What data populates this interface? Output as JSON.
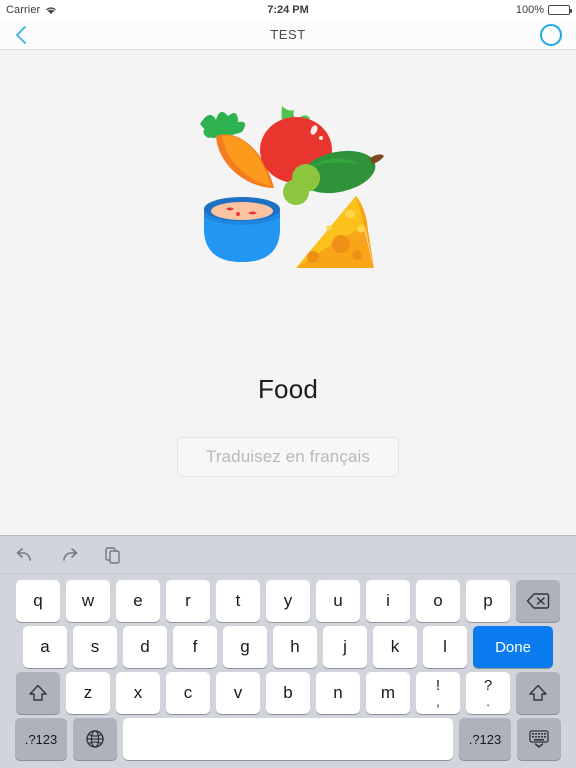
{
  "status_bar": {
    "carrier": "Carrier",
    "wifi_icon": "wifi-icon",
    "time": "7:24 PM",
    "battery_percent": "100%",
    "battery_icon": "battery-full-icon"
  },
  "nav_bar": {
    "back_icon": "chevron-left-icon",
    "title": "TEST",
    "right_icon": "circle-outline-icon",
    "accent_color": "#20a8e8"
  },
  "main": {
    "illustration_name": "food-illustration",
    "illustration_items": [
      "carrot",
      "tomato",
      "cucumber",
      "peas",
      "soup-bowl",
      "cheese-wedge"
    ],
    "word": "Food",
    "answer_input": {
      "value": "",
      "placeholder": "Traduisez en français"
    }
  },
  "keyboard": {
    "toolbar": [
      {
        "name": "undo-icon",
        "label": "undo"
      },
      {
        "name": "redo-icon",
        "label": "redo"
      },
      {
        "name": "paste-icon",
        "label": "paste"
      }
    ],
    "row1": [
      "q",
      "w",
      "e",
      "r",
      "t",
      "y",
      "u",
      "i",
      "o",
      "p"
    ],
    "row1_action": {
      "name": "backspace-key",
      "label": "delete"
    },
    "row2": [
      "a",
      "s",
      "d",
      "f",
      "g",
      "h",
      "j",
      "k",
      "l"
    ],
    "row2_action": {
      "name": "done-key",
      "label": "Done"
    },
    "row3": [
      "z",
      "x",
      "c",
      "v",
      "b",
      "n",
      "m"
    ],
    "row3_punctuation": [
      {
        "top": "!",
        "bottom": ","
      },
      {
        "top": "?",
        "bottom": "."
      }
    ],
    "shift_left": "shift-key",
    "shift_right": "shift-key",
    "row4": {
      "numbers_left": ".?123",
      "globe": "globe-key",
      "space": "",
      "numbers_right": ".?123",
      "dismiss": "dismiss-keyboard-key"
    },
    "done_color": "#0a7cf0"
  }
}
